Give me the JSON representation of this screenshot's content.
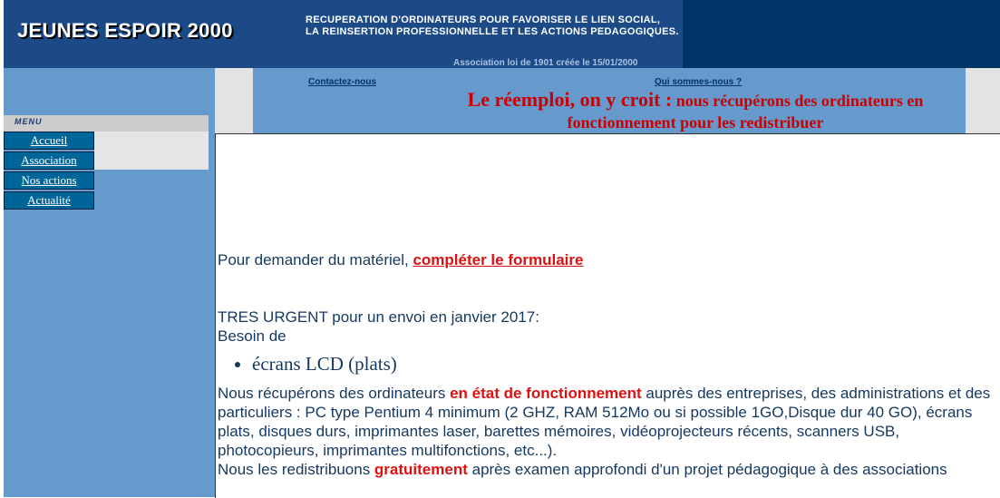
{
  "header": {
    "logo": "JEUNES ESPOIR 2000",
    "tagline_line1": "RECUPERATION D'ORDINATEURS POUR FAVORISER LE LIEN SOCIAL,",
    "tagline_line2": "LA REINSERTION PROFESSIONNELLE ET LES ACTIONS PEDAGOGIQUES.",
    "association": "Association loi de 1901 créée le 15/01/2000"
  },
  "menu": {
    "label": "MENU",
    "items": [
      {
        "label": "Accueil"
      },
      {
        "label": "Association"
      },
      {
        "label": "Nos actions"
      },
      {
        "label": "Actualité"
      }
    ]
  },
  "nav": {
    "contact": "Contactez-nous",
    "qui": "Qui sommes-nous ?",
    "slogan_big": "Le réemploi, on y croit :",
    "slogan_small": " nous récupérons des ordinateurs en fonctionnement pour les redistribuer"
  },
  "content": {
    "request_prefix": "Pour demander du matériel, ",
    "request_link": "compléter le formulaire ",
    "urgent": "TRES URGENT pour un envoi en janvier 2017:",
    "besoin": "Besoin de",
    "bullet": "écrans LCD (plats)",
    "recup_prefix": "Nous récupérons des ordinateurs ",
    "recup_highlight": "en état de fonctionnement",
    "recup_rest": " auprès des entreprises, des administrations et des particuliers : PC type Pentium 4 minimum (2 GHZ, RAM 512Mo ou si possible 1GO,Disque dur 40 GO), écrans plats, disques durs, imprimantes laser, barettes mémoires, vidéoprojecteurs récents, scanners USB, photocopieurs, imprimantes multifonctions, etc...).",
    "redist_prefix": "Nous les redistribuons ",
    "redist_highlight": "gratuitement",
    "redist_rest": " après examen approfondi d'un projet pédagogique à des associations"
  },
  "colors": {
    "header_bg": "#003366",
    "logo_bg": "#1b4a86",
    "sidebar_bg": "#6699cc",
    "menu_item_bg": "#006699",
    "accent_red": "#cc0000"
  }
}
